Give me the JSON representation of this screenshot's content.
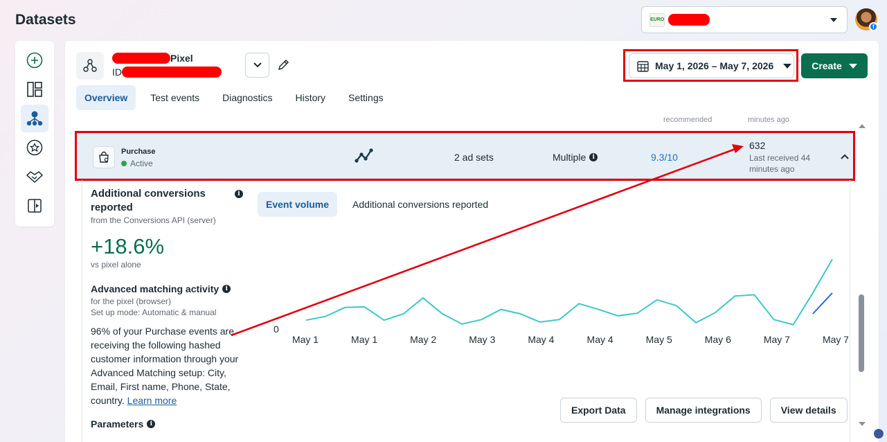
{
  "page": {
    "title": "Datasets"
  },
  "account": {
    "logo_text": "EURO",
    "name": "redacted"
  },
  "colors": {
    "accent": "#1b5c9e",
    "brand_green": "#0a6e4f",
    "annotation_red": "#e3000f",
    "chart_line": "#3cc8c8",
    "chart_line_2": "#2a6bd1"
  },
  "sidebar": {
    "items": [
      {
        "icon": "add-circle-icon",
        "active": false
      },
      {
        "icon": "layout-icon",
        "active": false
      },
      {
        "icon": "datasets-icon",
        "active": true
      },
      {
        "icon": "star-icon",
        "active": false
      },
      {
        "icon": "handshake-icon",
        "active": false
      },
      {
        "icon": "document-icon",
        "active": false
      }
    ]
  },
  "header": {
    "pixel_suffix": "Pixel",
    "id_label": "ID",
    "date_range": "May 1, 2026 – May 7, 2026",
    "create_label": "Create"
  },
  "tabs": [
    {
      "label": "Overview",
      "active": true
    },
    {
      "label": "Test events",
      "active": false
    },
    {
      "label": "Diagnostics",
      "active": false
    },
    {
      "label": "History",
      "active": false
    },
    {
      "label": "Settings",
      "active": false
    }
  ],
  "cut_off": {
    "recommended": "recommended",
    "minutes": "minutes ago"
  },
  "event": {
    "name": "Purchase",
    "status": "Active",
    "ad_sets": "2 ad sets",
    "integration": "Multiple",
    "quality_score": "9.3/10",
    "total_events": "632",
    "last_received": "Last received 44 minutes ago"
  },
  "details": {
    "additional_heading": "Additional conversions reported",
    "additional_source": "from the Conversions API (server)",
    "additional_pct": "+18.6%",
    "additional_vs": "vs pixel alone",
    "matching_heading": "Advanced matching activity",
    "matching_source": "for the pixel (browser)",
    "matching_mode": "Set up mode: Automatic & manual",
    "matching_body": "96% of your Purchase events are receiving the following hashed customer information through your Advanced Matching setup: City, Email, First name, Phone, State, country.",
    "learn_more": "Learn more",
    "parameters_heading": "Parameters"
  },
  "chart_tabs": [
    {
      "label": "Event volume",
      "active": true
    },
    {
      "label": "Additional conversions reported",
      "active": false
    }
  ],
  "chart_data": {
    "type": "line",
    "categories": [
      "May 1",
      "May 1",
      "May 2",
      "May 3",
      "May 4",
      "May 4",
      "May 5",
      "May 6",
      "May 7",
      "May 7"
    ],
    "ytick_zero": "0",
    "series": [
      {
        "values": [
          14,
          20,
          34,
          35,
          14,
          24,
          49,
          24,
          8,
          15,
          31,
          24,
          11,
          15,
          40,
          31,
          21,
          25,
          46,
          37,
          10,
          26,
          52,
          54,
          15,
          7,
          57,
          110
        ]
      },
      {
        "values": [
          null,
          null,
          null,
          null,
          null,
          null,
          null,
          null,
          null,
          null,
          null,
          null,
          null,
          null,
          null,
          null,
          null,
          null,
          null,
          null,
          null,
          null,
          null,
          null,
          null,
          null,
          24,
          57
        ]
      }
    ],
    "ylim": [
      0,
      120
    ]
  },
  "actions": {
    "export": "Export Data",
    "integrations": "Manage integrations",
    "view_details": "View details"
  }
}
